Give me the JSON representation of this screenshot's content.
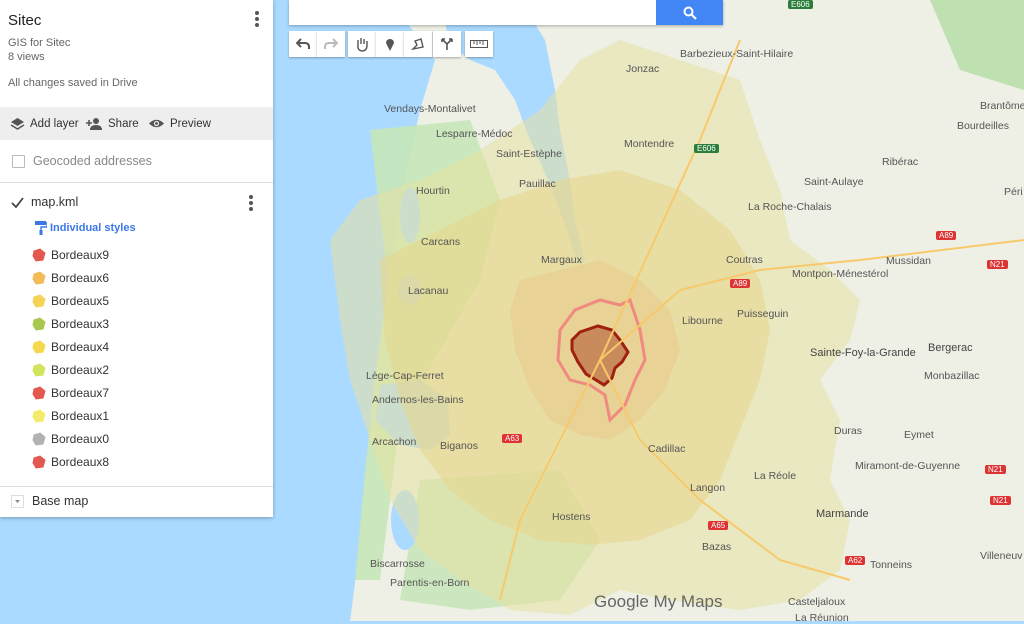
{
  "panel": {
    "title": "Sitec",
    "subtitle": "GIS for Sitec",
    "views": "8 views",
    "saved_status": "All changes saved in Drive",
    "toolbar": {
      "add_layer": "Add layer",
      "share": "Share",
      "preview": "Preview"
    },
    "geocoded_layer": "Geocoded addresses",
    "layer": {
      "name": "map.kml",
      "style_link": "Individual styles",
      "items": [
        {
          "label": "Bordeaux9",
          "color": "#e0483c"
        },
        {
          "label": "Bordeaux6",
          "color": "#f2b347"
        },
        {
          "label": "Bordeaux5",
          "color": "#f4cf47"
        },
        {
          "label": "Bordeaux3",
          "color": "#9fc13a"
        },
        {
          "label": "Bordeaux4",
          "color": "#f3d53a"
        },
        {
          "label": "Bordeaux2",
          "color": "#cfe04a"
        },
        {
          "label": "Bordeaux7",
          "color": "#e0483c"
        },
        {
          "label": "Bordeaux1",
          "color": "#f2ea5c"
        },
        {
          "label": "Bordeaux0",
          "color": "#aaaaaa"
        },
        {
          "label": "Bordeaux8",
          "color": "#e0483c"
        }
      ]
    },
    "base_map": "Base map"
  },
  "map_labels": {
    "jonzac": "Jonzac",
    "barbezieux": "Barbezieux-Saint-Hilaire",
    "brantome": "Brantôme",
    "vendays": "Vendays-Montalivet",
    "lesparre": "Lesparre-Médoc",
    "montendre": "Montendre",
    "bourdeilles": "Bourdeilles",
    "saint_estephe": "Saint-Estèphe",
    "riberac": "Ribérac",
    "pauillac": "Pauillac",
    "saint_aulaye": "Saint-Aulaye",
    "perigueux": "Péri",
    "hourtin": "Hourtin",
    "roche_chalais": "La Roche-Chalais",
    "carcans": "Carcans",
    "margaux": "Margaux",
    "mussidan": "Mussidan",
    "coutras": "Coutras",
    "montpon": "Montpon-Ménestérol",
    "lacanau": "Lacanau",
    "libourne": "Libourne",
    "puisseguin": "Puisseguin",
    "sainte_foy": "Sainte-Foy-la-Grande",
    "bergerac": "Bergerac",
    "lege": "Lège-Cap-Ferret",
    "monbazillac": "Monbazillac",
    "andernos": "Andernos-les-Bains",
    "duras": "Duras",
    "arcachon": "Arcachon",
    "biganos": "Biganos",
    "cadillac": "Cadillac",
    "eymet": "Eymet",
    "miramont": "Miramont-de-Guyenne",
    "la_reole": "La Réole",
    "langon": "Langon",
    "hostens": "Hostens",
    "marmande": "Marmande",
    "bazas": "Bazas",
    "biscarrosse": "Biscarrosse",
    "villeneuve": "Villeneuv",
    "parentis": "Parentis-en-Born",
    "tonneins": "Tonneins",
    "casteljaloux": "Casteljaloux",
    "la_reunion": "La Réunion"
  },
  "roads": {
    "e606_top": "E606",
    "e606": "E606",
    "a89_w": "A89",
    "a89_e": "A89",
    "n21_a": "N21",
    "n21_b": "N21",
    "n21_c": "N21",
    "a62": "A62",
    "a63": "A63",
    "a65": "A65"
  },
  "watermark": "Google My Maps",
  "colors": {
    "water": "#aadaff",
    "land": "#eef0e6",
    "accent": "#4285f4",
    "forest": "#c5e5b8"
  }
}
